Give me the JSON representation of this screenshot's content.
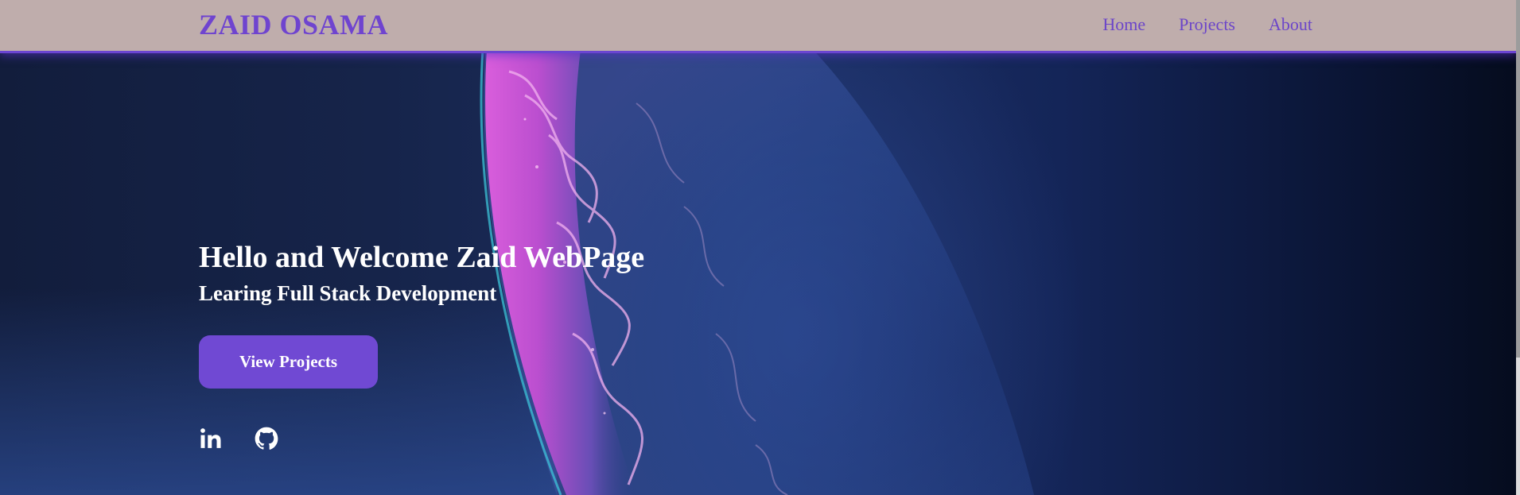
{
  "navbar": {
    "brand": "ZAID OSAMA",
    "links": [
      {
        "label": "Home"
      },
      {
        "label": "Projects"
      },
      {
        "label": "About"
      }
    ]
  },
  "hero": {
    "title": "Hello and Welcome Zaid WebPage",
    "subtitle": "Learing Full Stack Development",
    "cta_label": "View Projects",
    "socials": [
      {
        "icon": "linkedin-icon"
      },
      {
        "icon": "github-icon"
      }
    ]
  },
  "colors": {
    "accent": "#6f44cf",
    "navbar_bg": "#bfadac",
    "button_bg": "#7049d3"
  }
}
